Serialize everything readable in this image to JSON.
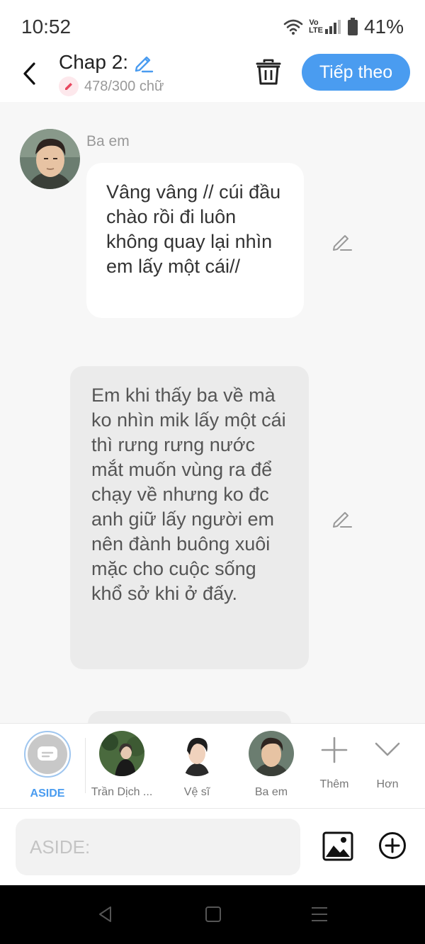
{
  "status": {
    "time": "10:52",
    "lte": "Vo\nLTE",
    "battery": "41%"
  },
  "header": {
    "title": "Chap 2:",
    "word_count": "478/300 chữ",
    "next_label": "Tiếp theo"
  },
  "messages": [
    {
      "sender": "Ba em",
      "text": "Vâng vâng // cúi đầu chào rồi đi luôn không quay lại nhìn em lấy một cái//"
    },
    {
      "sender": "",
      "text": "Em khi thấy ba về mà ko nhìn mik lấy một cái thì rưng rưng nước mắt muốn vùng ra để chạy về nhưng ko đc anh giữ lấy người em nên đành buông xuôi mặc cho cuộc sống khổ sở khi ở đấy."
    }
  ],
  "characters": [
    {
      "label": "ASIDE"
    },
    {
      "label": "Trần Dịch ..."
    },
    {
      "label": "Vệ sĩ"
    },
    {
      "label": "Ba em"
    },
    {
      "label": "Thêm"
    },
    {
      "label": "Hơn"
    }
  ],
  "input": {
    "placeholder": "ASIDE:"
  },
  "colors": {
    "accent": "#4a9cf0",
    "title_edit": "#4a9cf0",
    "count_pencil": "#e8475f"
  }
}
